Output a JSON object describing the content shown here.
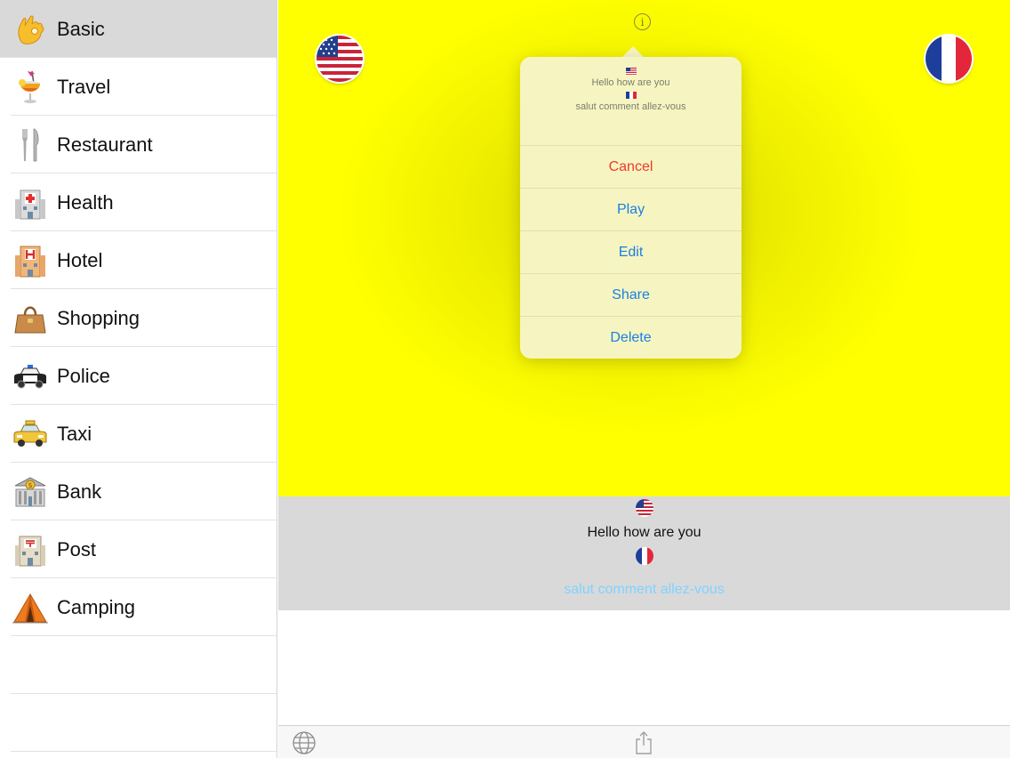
{
  "sidebar": {
    "selected": "basic",
    "items": [
      {
        "id": "basic",
        "label": "Basic",
        "icon": "ok-hand-icon"
      },
      {
        "id": "travel",
        "label": "Travel",
        "icon": "tropical-drink-icon"
      },
      {
        "id": "restaurant",
        "label": "Restaurant",
        "icon": "fork-knife-icon"
      },
      {
        "id": "health",
        "label": "Health",
        "icon": "hospital-icon"
      },
      {
        "id": "hotel",
        "label": "Hotel",
        "icon": "hotel-icon"
      },
      {
        "id": "shopping",
        "label": "Shopping",
        "icon": "handbag-icon"
      },
      {
        "id": "police",
        "label": "Police",
        "icon": "police-car-icon"
      },
      {
        "id": "taxi",
        "label": "Taxi",
        "icon": "taxi-icon"
      },
      {
        "id": "bank",
        "label": "Bank",
        "icon": "bank-icon"
      },
      {
        "id": "post",
        "label": "Post",
        "icon": "post-office-icon"
      },
      {
        "id": "camping",
        "label": "Camping",
        "icon": "tent-icon"
      }
    ]
  },
  "main": {
    "source_language_icon": "us-flag-icon",
    "target_language_icon": "france-flag-icon",
    "info_icon": "info-icon",
    "popover": {
      "source_text": "Hello how are you",
      "target_text": "salut comment allez-vous",
      "actions": {
        "cancel": "Cancel",
        "play": "Play",
        "edit": "Edit",
        "share": "Share",
        "delete": "Delete"
      }
    },
    "translation": {
      "source_text": "Hello how are you",
      "target_text": "salut comment allez-vous"
    }
  },
  "toolbar": {
    "left_icon": "globe-icon",
    "center_icon": "share-icon"
  },
  "colors": {
    "background_yellow": "#ffff00",
    "popover_bg": "#f6f5c2",
    "action_blue": "#1a7fe3",
    "destructive_red": "#ee3a2c",
    "translation_text": "#7fd3ff",
    "panel_gray": "#d9d9da"
  }
}
